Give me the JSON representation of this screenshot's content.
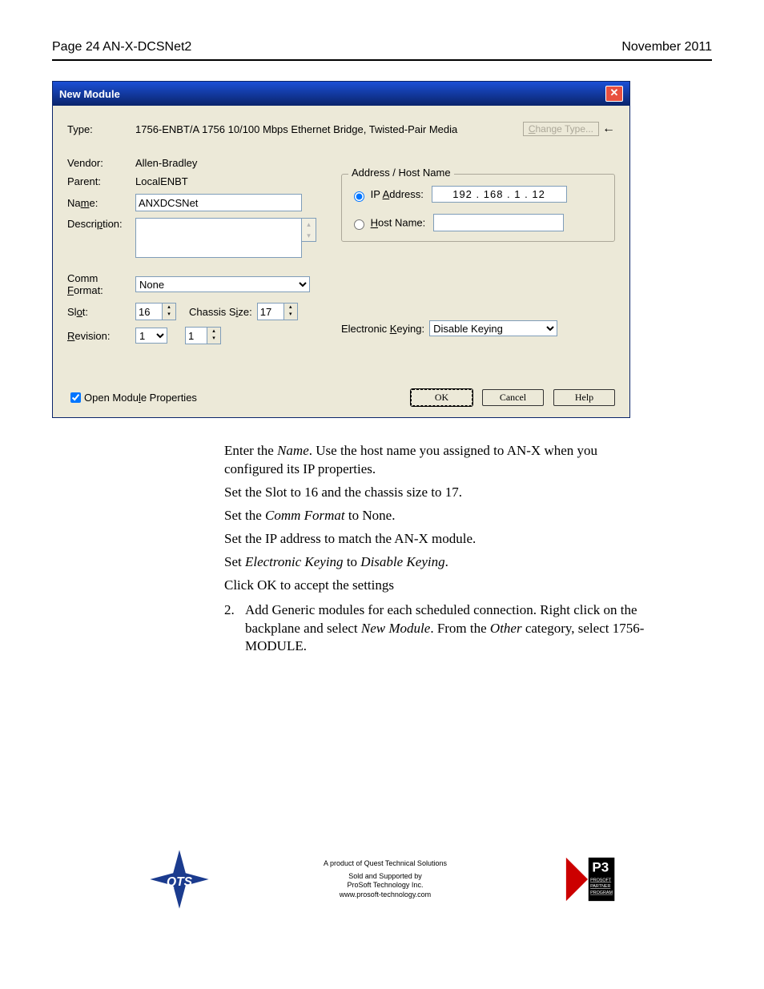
{
  "header": {
    "left": "Page  24  AN-X-DCSNet2",
    "right": "November 2011"
  },
  "dialog": {
    "title": "New Module",
    "close": "✕",
    "type_label": "Type:",
    "type_value": "1756-ENBT/A 1756 10/100 Mbps Ethernet Bridge, Twisted-Pair Media",
    "change_type_btn": "Change Type...",
    "vendor_label": "Vendor:",
    "vendor_value": "Allen-Bradley",
    "parent_label": "Parent:",
    "parent_value": "LocalENBT",
    "name_label_pre": "Na",
    "name_label_u": "m",
    "name_label_post": "e:",
    "name_value": "ANXDCSNet",
    "desc_label_pre": "Descri",
    "desc_label_u": "p",
    "desc_label_post": "tion:",
    "desc_value": "",
    "comm_label_pre": "Comm ",
    "comm_label_u": "F",
    "comm_label_post": "ormat:",
    "comm_value": "None",
    "slot_label_pre": "Sl",
    "slot_label_u": "o",
    "slot_label_post": "t:",
    "slot_value": "16",
    "chassis_label_pre": "Chassis S",
    "chassis_label_u": "i",
    "chassis_label_post": "ze:",
    "chassis_value": "17",
    "rev_label_u": "R",
    "rev_label_post": "evision:",
    "rev_major": "1",
    "rev_minor": "1",
    "addr_legend": "Address / Host Name",
    "ip_label_pre": "IP ",
    "ip_label_u": "A",
    "ip_label_post": "ddress:",
    "ip_value": "192  .  168  .   1   .   12",
    "host_label_u": "H",
    "host_label_post": "ost Name:",
    "host_value": "",
    "keying_label_pre": "Electronic ",
    "keying_label_u": "K",
    "keying_label_post": "eying:",
    "keying_value": "Disable Keying",
    "open_props_pre": "Open Modu",
    "open_props_u": "l",
    "open_props_post": "e Properties",
    "ok": "OK",
    "cancel": "Cancel",
    "help": "Help"
  },
  "body": {
    "p1a": "Enter the ",
    "p1b": "Name",
    "p1c": ".  Use the host name you assigned to AN-X when you configured its IP properties.",
    "p2": "Set the Slot to 16 and the chassis size to 17.",
    "p3a": "Set the ",
    "p3b": "Comm Format",
    "p3c": " to None.",
    "p4": "Set the IP address to match the AN-X module.",
    "p5a": "Set ",
    "p5b": "Electronic Keying",
    "p5c": " to ",
    "p5d": "Disable Keying",
    "p5e": ".",
    "p6": "Click OK to accept the settings",
    "list_num": "2.",
    "list_a": "Add Generic modules for each scheduled connection.  Right click on the backplane and select ",
    "list_b": "New Module",
    "list_c": ".  From the ",
    "list_d": "Other",
    "list_e": " category, select 1756-MODULE."
  },
  "footer": {
    "line1": "A product of Quest Technical Solutions",
    "line2": "Sold and Supported by",
    "line3": "ProSoft Technology Inc.",
    "line4": "www.prosoft-technology.com"
  }
}
